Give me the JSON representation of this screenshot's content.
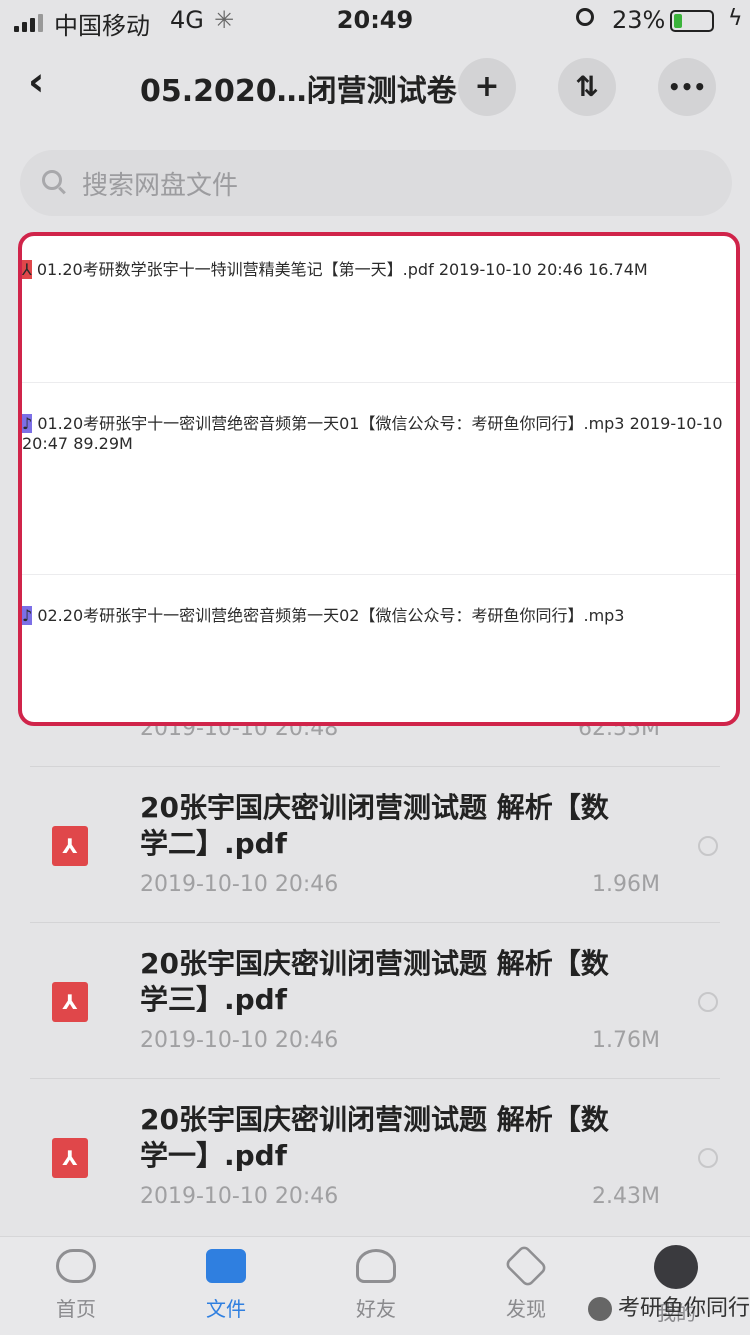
{
  "status": {
    "carrier": "中国移动",
    "network": "4G",
    "time": "20:49",
    "battery": "23%",
    "battery_level": 0.23
  },
  "nav": {
    "back_icon": "chevron-left-icon",
    "title": "05.2020…闭营测试卷",
    "add_label": "+",
    "sort_label": "⇅",
    "more_label": "•••"
  },
  "search": {
    "placeholder": "搜索网盘文件"
  },
  "highlighted_files": [
    {
      "icon": "pdf-file-icon",
      "name": "01.20考研数学张宇十一特训营精美笔记【第一天】.pdf",
      "date": "2019-10-10 20:46",
      "size": "16.74M"
    },
    {
      "icon": "audio-file-icon",
      "name": "01.20考研张宇十一密训营绝密音频第一天01【微信公众号：考研鱼你同行】.mp3",
      "date": "2019-10-10 20:47",
      "size": "89.29M"
    },
    {
      "icon": "audio-file-icon",
      "name": "02.20考研张宇十一密训营绝密音频第一天02【微信公众号：考研鱼你同行】.mp3",
      "date": "",
      "size": ""
    }
  ],
  "peek_row": {
    "date": "2019-10-10 20:48",
    "size": "62.55M"
  },
  "files": [
    {
      "icon": "pdf-file-icon",
      "name": "20张宇国庆密训闭营测试题 解析【数学二】.pdf",
      "date": "2019-10-10 20:46",
      "size": "1.96M"
    },
    {
      "icon": "pdf-file-icon",
      "name": "20张宇国庆密训闭营测试题 解析【数学三】.pdf",
      "date": "2019-10-10 20:46",
      "size": "1.76M"
    },
    {
      "icon": "pdf-file-icon",
      "name": "20张宇国庆密训闭营测试题 解析【数学一】.pdf",
      "date": "2019-10-10 20:46",
      "size": "2.43M"
    }
  ],
  "tabs": [
    {
      "label": "首页",
      "icon": "cloud-icon"
    },
    {
      "label": "文件",
      "icon": "folder-icon",
      "active": true
    },
    {
      "label": "好友",
      "icon": "friends-icon"
    },
    {
      "label": "发现",
      "icon": "discover-icon"
    },
    {
      "label": "我的",
      "icon": "avatar-icon"
    }
  ],
  "watermark": "考研鱼你同行",
  "colors": {
    "accent": "#2f7fe0",
    "highlight_border": "#d0244a",
    "pdf": "#e0474a",
    "audio": "#7c6fe6"
  }
}
